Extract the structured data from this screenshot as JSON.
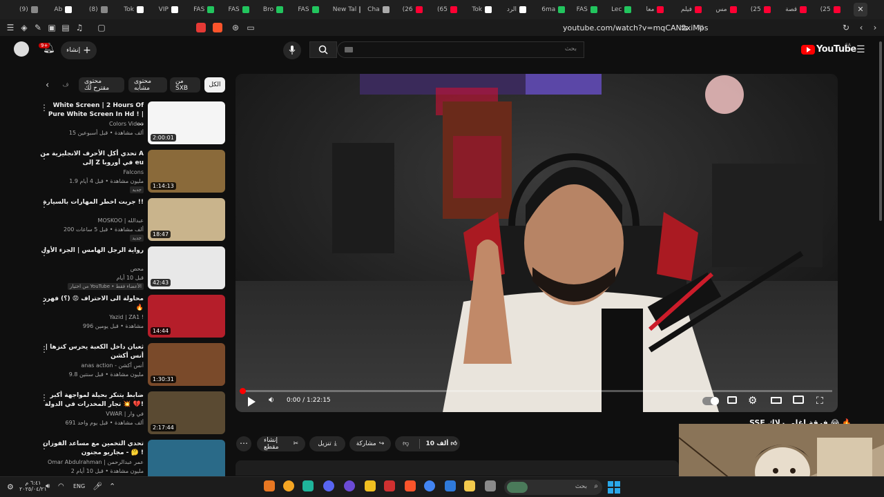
{
  "browser": {
    "tabs": [
      {
        "label": "(9)",
        "color": "#888888"
      },
      {
        "label": "Ab",
        "color": "#ffffff"
      },
      {
        "label": "(8)",
        "color": "#888888"
      },
      {
        "label": "Tok",
        "color": "#ffffff"
      },
      {
        "label": "VIP",
        "color": "#ffffff"
      },
      {
        "label": "FAS",
        "color": "#22c55e"
      },
      {
        "label": "FAS",
        "color": "#22c55e"
      },
      {
        "label": "Bro",
        "color": "#22c55e"
      },
      {
        "label": "FAS",
        "color": "#22c55e"
      },
      {
        "label": "New Tal",
        "color": "#888888"
      },
      {
        "label": "Cha",
        "color": "#aaaaaa"
      },
      {
        "label": "(26",
        "color": "#ff0033"
      },
      {
        "label": "(65",
        "color": "#ff0033"
      },
      {
        "label": "Tok",
        "color": "#ffffff"
      },
      {
        "label": "الرد",
        "color": "#ffffff"
      },
      {
        "label": "6ma",
        "color": "#22c55e"
      },
      {
        "label": "FAS",
        "color": "#22c55e"
      },
      {
        "label": "Lec",
        "color": "#22c55e"
      },
      {
        "label": "معا",
        "color": "#ff0033"
      },
      {
        "label": "فيلم",
        "color": "#ff0033"
      },
      {
        "label": "مس",
        "color": "#ff0033"
      },
      {
        "label": "(25",
        "color": "#ff0033"
      },
      {
        "label": "قصة",
        "color": "#ff0033"
      },
      {
        "label": "(25",
        "color": "#ff0033"
      }
    ],
    "url": "youtube.com/watch?v=mqCAN2xiMps"
  },
  "masthead": {
    "logo": "YouTube",
    "country": "SA",
    "search_placeholder": "بحث",
    "create_label": "إنشاء",
    "notifications": "9+"
  },
  "chips": [
    "الكل",
    "من SXB",
    "محتوى مشابه",
    "محتوى مقترح لك",
    "ف"
  ],
  "recommendations": [
    {
      "title": "White Screen | 2 Hours Of Pure White Screen In Hd ! | ...",
      "channel": "Colors Video",
      "meta": "15 ألف مشاهدة • قبل أسبوعين",
      "duration": "2:00:01",
      "badge": "",
      "thumb": "#f5f5f5"
    },
    {
      "title": "تحدي أكل الأحرف الانجليزية من A إلى Z في أوروبا eu",
      "channel": "Falcons",
      "meta": "1.9 مليون مشاهدة • قبل 4 أيام",
      "duration": "1:14:13",
      "badge": "جديد",
      "thumb": "#8a6a3a"
    },
    {
      "title": "جربت اخطر المهارات بالسيارة !!",
      "channel": "MOSKOO | عبدالله",
      "meta": "200 ألف مشاهدة • قبل 5 ساعات",
      "duration": "18:47",
      "badge": "جديد",
      "thumb": "#c9b48c"
    },
    {
      "title": "رواية الرجل الهامس | الجزء الأول",
      "channel": "محص",
      "meta": "قبل 10 أيام",
      "duration": "42:43",
      "badge": "من اختيار YouTube • الأعضاء فقط",
      "thumb": "#e8e8e8"
    },
    {
      "title": "محاولة الى الاحتراف 😡 (؟) فهرر 🔥",
      "channel": "Yazid | ZA1 !",
      "meta": "996 مشاهدة • قبل يومين",
      "duration": "14:44",
      "badge": "",
      "thumb": "#b51e2a"
    },
    {
      "title": "ثعبان داخل الكعبة يحرس كنزها | أنس أكشن",
      "channel": "anas action - أنس أكشن",
      "meta": "9.8 مليون مشاهدة • قبل سنتين",
      "duration": "1:30:31",
      "badge": "",
      "thumb": "#7a4a2a"
    },
    {
      "title": "ضابط يتنكر بحيلة لمواجهة أكبر تجار المخدرات في الدولة 💥 💔!",
      "channel": "VWAR | في وار",
      "meta": "691 ألف مشاهدة • قبل يوم واحد",
      "duration": "2:17:44",
      "badge": "",
      "thumb": "#5a4a32"
    },
    {
      "title": "تحدي التخمين مع مساعد الفوزان - مجاريو مجنون 🤔 !",
      "channel": "Omar Abdulrahman | عمر عبدالرحمن",
      "meta": "2 مليون مشاهدة • قبل 10 أيام",
      "duration": "",
      "badge": "",
      "thumb": "#2a6a88"
    }
  ],
  "player": {
    "time": "0:00 / 1:22:15",
    "progress_percent": 0
  },
  "video_title_fragment": "SSE فرقة اغلى رلاك 😂 🔥",
  "actions": {
    "like": "10 ألف",
    "share": "مشاركة",
    "download": "تنزيل",
    "clip": "إنشاء مقطع"
  },
  "taskbar": {
    "search_placeholder": "بحث",
    "lang": "ENG",
    "time": "٦:٤١ م",
    "date": "٢٠٢٥/٠٤/٢١"
  }
}
